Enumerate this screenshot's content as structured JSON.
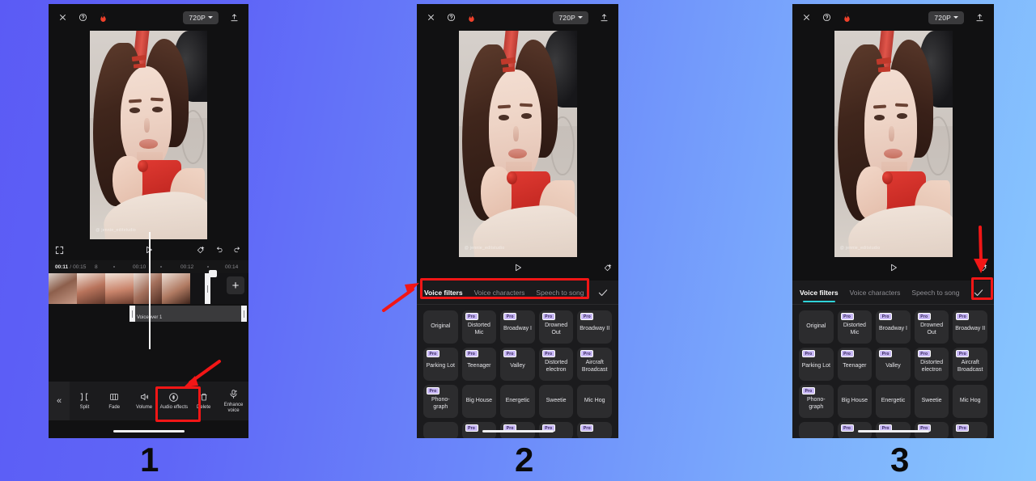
{
  "background": {
    "gradient_from": "#5b5bf5",
    "gradient_to": "#88c7fe"
  },
  "steps": [
    {
      "label": "1"
    },
    {
      "label": "2"
    },
    {
      "label": "3"
    }
  ],
  "app": {
    "topbar": {
      "close_icon": "close-icon",
      "help_icon": "help-icon",
      "flame_icon": "flame-icon",
      "resolution": "720P",
      "export_icon": "export-icon"
    },
    "player": {
      "fullscreen_icon": "fullscreen-icon",
      "play_icon": "play-icon",
      "magic_icon": "magic-wand-icon",
      "undo_icon": "undo-icon",
      "redo_icon": "redo-icon"
    },
    "timeline": {
      "current_time": "00:11",
      "separator": "/",
      "total_time": "00:15",
      "ticks": [
        "8",
        "00:10",
        "00:12",
        "00:14"
      ],
      "add_clip_label": "+",
      "voiceover_clip_label": "Voiceover 1"
    },
    "toolbar": {
      "collapse_label": "«",
      "items": [
        {
          "label": "Split",
          "icon": "split-icon"
        },
        {
          "label": "Fade",
          "icon": "fade-icon"
        },
        {
          "label": "Volume",
          "icon": "volume-icon"
        },
        {
          "label": "Audio effects",
          "icon": "audio-effects-icon"
        },
        {
          "label": "Delete",
          "icon": "trash-icon"
        },
        {
          "label": "Enhance voice",
          "icon": "enhance-voice-icon"
        }
      ]
    },
    "voice_sheet": {
      "tabs": [
        {
          "label": "Voice filters",
          "active": true
        },
        {
          "label": "Voice characters",
          "active": false
        },
        {
          "label": "Speech to song",
          "active": false
        }
      ],
      "confirm_icon": "checkmark-icon",
      "active_underline_color": "#2fd3d8",
      "pro_badge_label": "Pro",
      "filters": [
        {
          "name": "Original",
          "pro": false
        },
        {
          "name": "Distorted Mic",
          "pro": true
        },
        {
          "name": "Broadway I",
          "pro": true
        },
        {
          "name": "Drowned Out",
          "pro": true
        },
        {
          "name": "Broadway II",
          "pro": true
        },
        {
          "name": "Parking Lot",
          "pro": true
        },
        {
          "name": "Teenager",
          "pro": true
        },
        {
          "name": "Valley",
          "pro": true
        },
        {
          "name": "Distorted electron",
          "pro": true
        },
        {
          "name": "Aircraft Broadcast",
          "pro": true
        },
        {
          "name": "Phono-graph",
          "pro": true
        },
        {
          "name": "Big House",
          "pro": false
        },
        {
          "name": "Energetic",
          "pro": false
        },
        {
          "name": "Sweetie",
          "pro": false
        },
        {
          "name": "Mic Hog",
          "pro": false
        }
      ],
      "partial_row": [
        {
          "name": "",
          "pro": false
        },
        {
          "name": "",
          "pro": true
        },
        {
          "name": "",
          "pro": true
        },
        {
          "name": "",
          "pro": true
        },
        {
          "name": "",
          "pro": true
        }
      ]
    },
    "video_watermark": "@ jennie_editstudio"
  },
  "annotations": {
    "highlight_color": "#f21616",
    "panel1_target": "Audio effects",
    "panel2_target": "Voice filters tab bar",
    "panel3_target": "confirm checkmark"
  }
}
